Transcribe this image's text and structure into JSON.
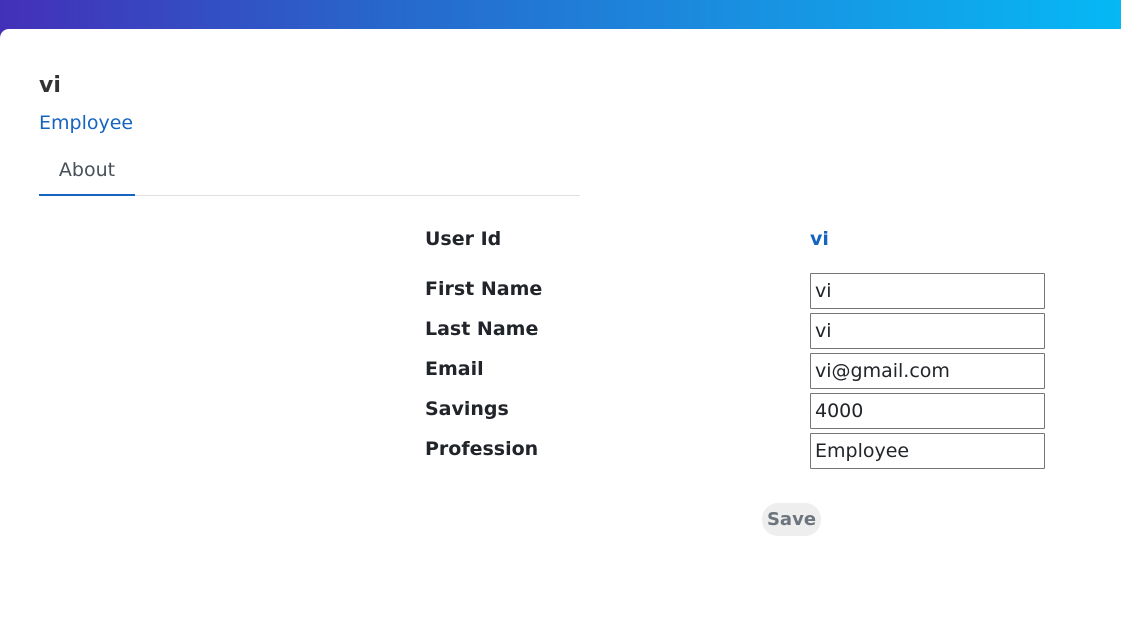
{
  "profile": {
    "name": "vi",
    "role": "Employee"
  },
  "tabs": [
    {
      "label": "About",
      "active": true
    }
  ],
  "form": {
    "user_id": {
      "label": "User Id",
      "value": "vi"
    },
    "fields": [
      {
        "label": "First Name",
        "value": "vi"
      },
      {
        "label": "Last Name",
        "value": "vi"
      },
      {
        "label": "Email",
        "value": "vi@gmail.com"
      },
      {
        "label": "Savings",
        "value": "4000"
      },
      {
        "label": "Profession",
        "value": "Employee"
      }
    ],
    "save_label": "Save"
  },
  "colors": {
    "accent": "#1565c0",
    "header_gradient_start": "#4330b9",
    "header_gradient_end": "#06b8f5"
  }
}
